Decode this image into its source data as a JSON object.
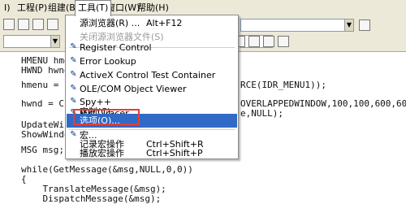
{
  "menubar": {
    "items": [
      {
        "label": "I)"
      },
      {
        "label": "工程(P)"
      },
      {
        "label": "组建(B)"
      },
      {
        "label": "工具(T)"
      },
      {
        "label": "窗口(W)"
      },
      {
        "label": "帮助(H)"
      }
    ]
  },
  "tools_menu": {
    "items": [
      {
        "label": "源浏览器(R)  ...",
        "shortcut": "Alt+F12"
      },
      {
        "label": "关闭源浏览器文件(S)",
        "shortcut": ""
      },
      {
        "label": "Register Control",
        "shortcut": "",
        "icon": "register-control-icon"
      },
      {
        "label": "Error Lookup",
        "shortcut": "",
        "icon": "error-lookup-icon"
      },
      {
        "label": "ActiveX Control Test Container",
        "shortcut": "",
        "icon": "activex-icon"
      },
      {
        "label": "OLE/COM Object Viewer",
        "shortcut": "",
        "icon": "ole-viewer-icon"
      },
      {
        "label": "Spy++",
        "shortcut": "",
        "icon": "spy-icon"
      },
      {
        "label": "MFC Tracer",
        "shortcut": "",
        "icon": "mfc-tracer-icon"
      },
      {
        "label": "定制(C)...",
        "shortcut": ""
      },
      {
        "label": "选项(O)...",
        "shortcut": ""
      },
      {
        "label": "宏...",
        "shortcut": "",
        "icon": "macro-icon"
      },
      {
        "label": "记录宏操作",
        "shortcut": "Ctrl+Shift+R"
      },
      {
        "label": "播放宏操作",
        "shortcut": "Ctrl+Shift+P"
      }
    ]
  },
  "code": {
    "lines": [
      "HMENU hmenu",
      "HWND hwnd;",
      "hmenu = Loa",
      "hwnd = Crea",
      "UpdateWindo",
      "ShowWindow",
      "MSG msg;",
      "while(GetMessage(&msg,NULL,0,0))",
      "{",
      "    TranslateMessage(&msg);",
      "    DispatchMessage(&msg);",
      "}"
    ],
    "right_fragments": [
      "RCE(IDR_MENU1));",
      "OVERLAPPEDWINDOW,100,100,600,600,",
      "e,NULL);"
    ]
  }
}
